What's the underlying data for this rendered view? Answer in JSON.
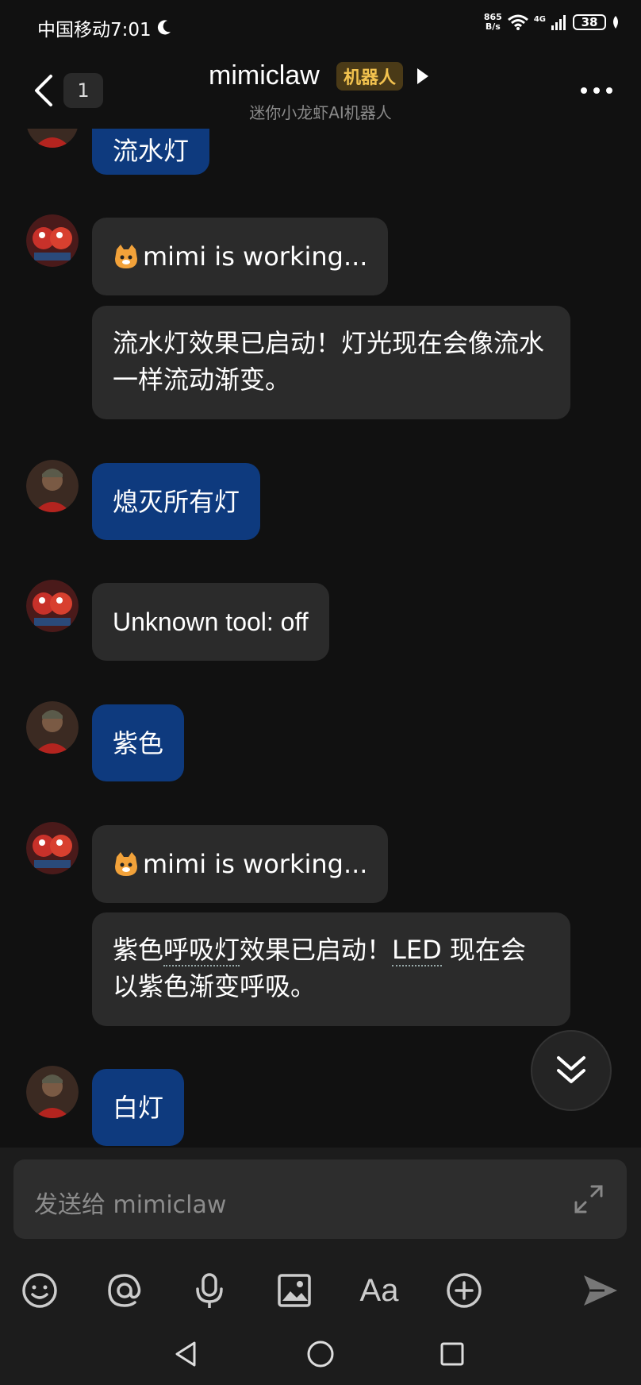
{
  "status": {
    "carrier_time": "中国移动7:01",
    "net_speed_top": "865",
    "net_speed_bottom": "B/s",
    "network_gen": "4G",
    "battery": "38"
  },
  "header": {
    "unread_count": "1",
    "title": "mimiclaw",
    "tag": "机器人",
    "subtitle": "迷你小龙虾AI机器人"
  },
  "messages": [
    {
      "sender": "user",
      "text": "流水灯"
    },
    {
      "sender": "bot",
      "text": "mimi is working..."
    },
    {
      "sender": "bot",
      "text": "流水灯效果已启动！灯光现在会像流水一样流动渐变。"
    },
    {
      "sender": "user",
      "text": "熄灭所有灯"
    },
    {
      "sender": "bot",
      "text": "Unknown tool: off"
    },
    {
      "sender": "user",
      "text": "紫色"
    },
    {
      "sender": "bot",
      "text": "mimi is working..."
    },
    {
      "sender": "bot",
      "text_parts": [
        "紫色",
        "呼吸灯",
        "效果已启动！",
        "LED",
        " 现在会以紫色渐变呼吸。"
      ]
    },
    {
      "sender": "user",
      "text": "白灯"
    }
  ],
  "composer": {
    "placeholder": "发送给 mimiclaw"
  },
  "toolbar": {
    "icons": [
      "emoji-icon",
      "mention-icon",
      "microphone-icon",
      "image-icon",
      "font-icon",
      "plus-icon",
      "send-icon"
    ],
    "font_label": "Aa"
  },
  "colors": {
    "background": "#111111",
    "user_bubble": "#0e3a7e",
    "bot_bubble": "#2b2b2b",
    "tag_text": "#f2c24e"
  }
}
